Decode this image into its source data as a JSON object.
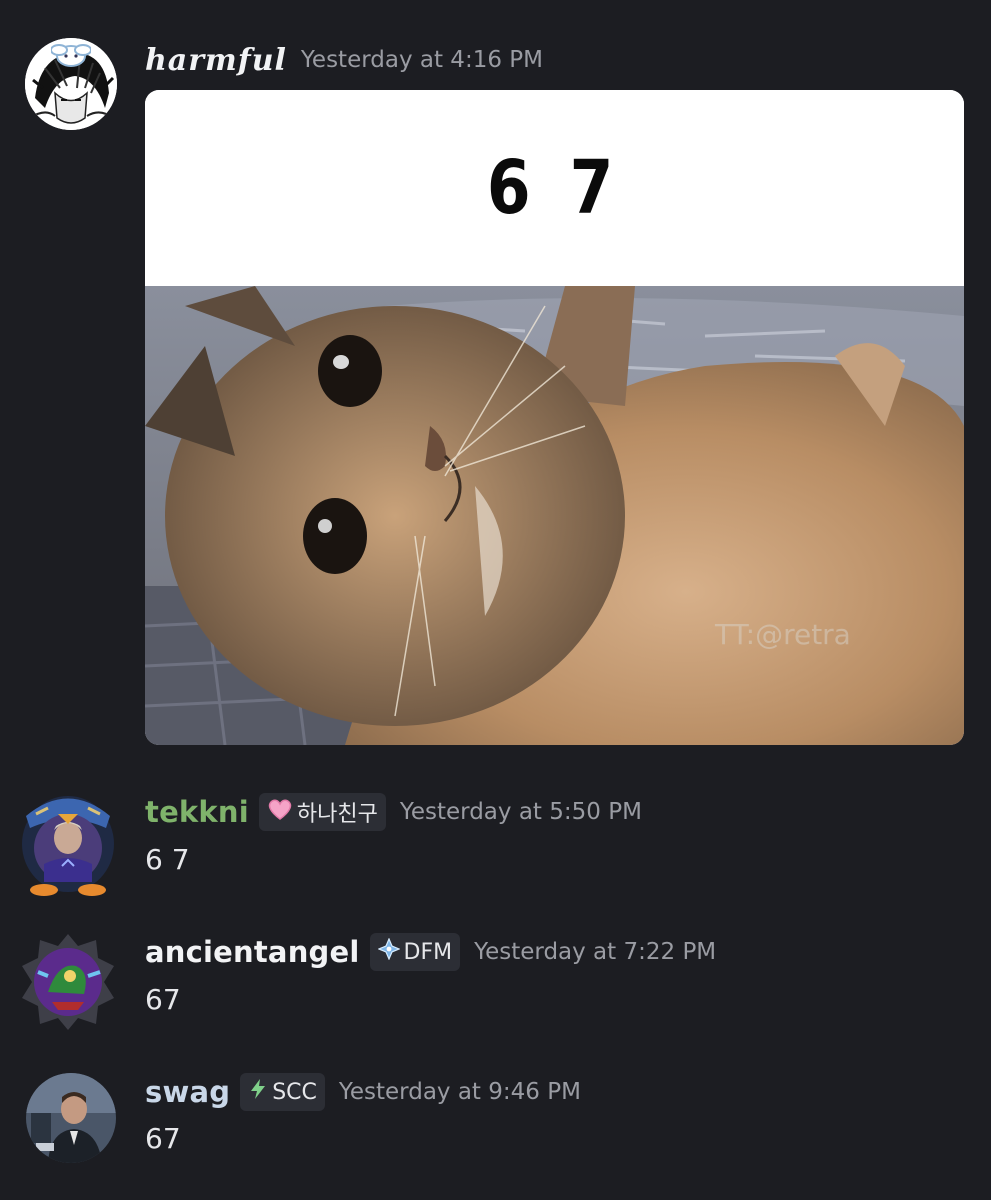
{
  "messages": [
    {
      "username": "harmful",
      "timestamp": "Yesterday at 4:16 PM",
      "embed": {
        "caption": "6 7",
        "watermark": "TT:@retra"
      }
    },
    {
      "username": "tekkni",
      "username_color": "#7fb36b",
      "tag": {
        "icon": "pink-heart-icon",
        "label": "하나친구"
      },
      "timestamp": "Yesterday at 5:50 PM",
      "text": "6 7"
    },
    {
      "username": "ancientangel",
      "username_color": "#f2f3f5",
      "tag": {
        "icon": "sparkle-diamond-icon",
        "label": "DFM"
      },
      "timestamp": "Yesterday at 7:22 PM",
      "text": "67"
    },
    {
      "username": "swag",
      "username_color": "#c9d7e8",
      "tag": {
        "icon": "lightning-icon",
        "label": "SCC"
      },
      "timestamp": "Yesterday at 9:46 PM",
      "text": "67"
    }
  ],
  "colors": {
    "background": "#1c1d22",
    "timestamp": "#9a9ca3",
    "tag_background": "#2c2e35"
  }
}
